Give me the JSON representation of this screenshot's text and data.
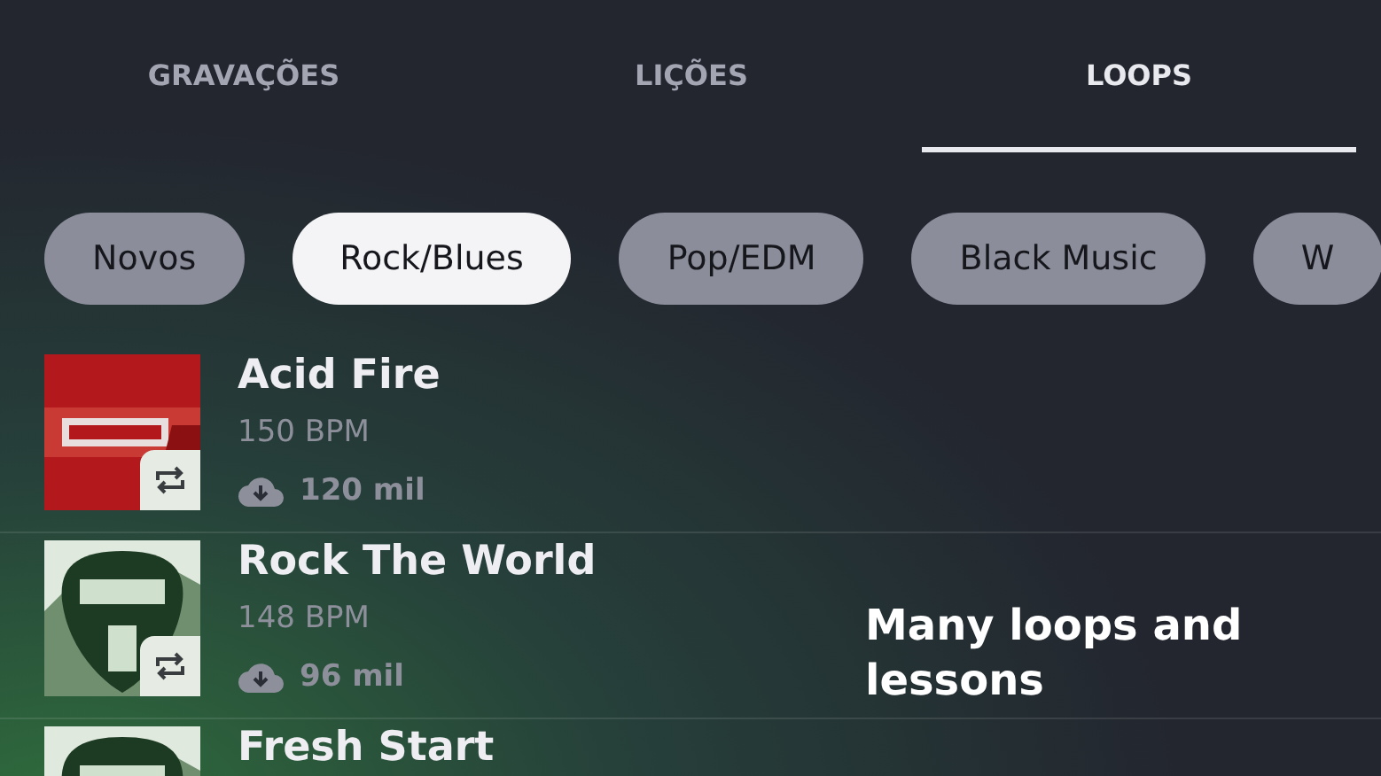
{
  "tabs": [
    {
      "label": "GRAVAÇÕES",
      "selected": false
    },
    {
      "label": "LIÇÕES",
      "selected": false
    },
    {
      "label": "LOOPS",
      "selected": true
    }
  ],
  "chips": [
    {
      "label": "Novos",
      "selected": false
    },
    {
      "label": "Rock/Blues",
      "selected": true
    },
    {
      "label": "Pop/EDM",
      "selected": false
    },
    {
      "label": "Black Music",
      "selected": false
    },
    {
      "label": "W",
      "selected": false
    }
  ],
  "loops": [
    {
      "title": "Acid Fire",
      "bpm": "150 BPM",
      "downloads": "120 mil"
    },
    {
      "title": "Rock The World",
      "bpm": "148 BPM",
      "downloads": "96 mil"
    },
    {
      "title": "Fresh Start"
    }
  ],
  "caption": "Many loops and lessons"
}
